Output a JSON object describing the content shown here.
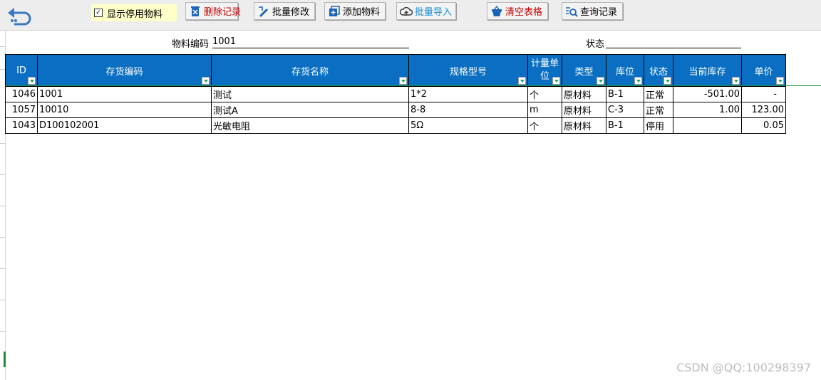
{
  "toolbar": {
    "show_disabled_label": "显示停用物料",
    "show_disabled_checked": "✓",
    "delete_label": "删除记录",
    "batch_edit_label": "批量修改",
    "add_label": "添加物料",
    "import_label": "批量导入",
    "clear_label": "清空表格",
    "query_label": "查询记录"
  },
  "filters": {
    "code_label": "物料编码",
    "code_value": "1001",
    "status_label": "状态",
    "status_value": ""
  },
  "table": {
    "headers": [
      "ID",
      "存货编码",
      "存货名称",
      "规格型号",
      "计量单位",
      "类型",
      "库位",
      "状态",
      "当前库存",
      "单价"
    ],
    "rows": [
      [
        "1046",
        "1001",
        "测试",
        "1*2",
        "个",
        "原材料",
        "B-1",
        "正常",
        "-501.00",
        "-"
      ],
      [
        "1057",
        "10010",
        "测试A",
        "8-8",
        "m",
        "原材料",
        "C-3",
        "正常",
        "1.00",
        "123.00"
      ],
      [
        "1043",
        "D100102001",
        "光敏电阻",
        "5Ω",
        "个",
        "原材料",
        "B-1",
        "停用",
        "",
        "0.05"
      ]
    ]
  },
  "watermark": "CSDN @QQ:100298397",
  "colors": {
    "header_bg": "#0a6fc2",
    "checkbox_bg": "#ffffc8",
    "delete_text": "#c00000",
    "import_text": "#1a8fd6",
    "clear_text": "#c00000"
  }
}
